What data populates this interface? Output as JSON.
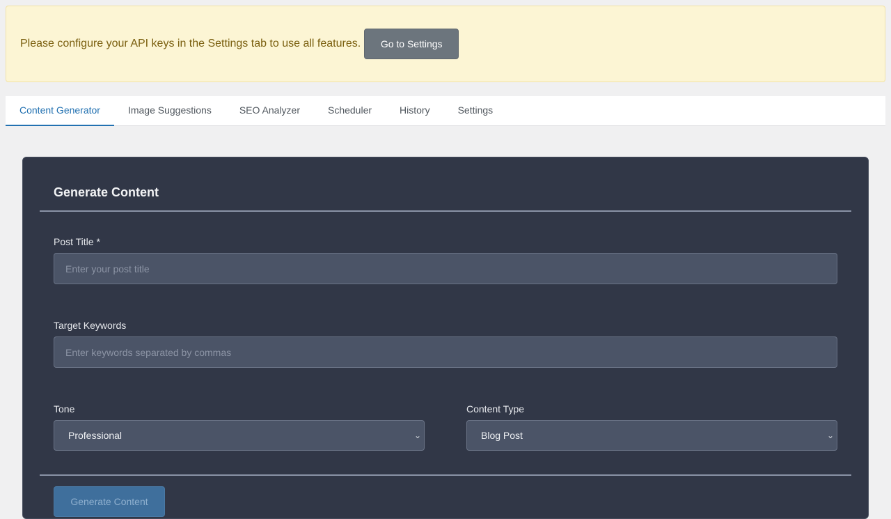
{
  "notice": {
    "message": "Please configure your API keys in the Settings tab to use all features.",
    "button_label": "Go to Settings"
  },
  "tabs": [
    {
      "label": "Content Generator",
      "active": true
    },
    {
      "label": "Image Suggestions",
      "active": false
    },
    {
      "label": "SEO Analyzer",
      "active": false
    },
    {
      "label": "Scheduler",
      "active": false
    },
    {
      "label": "History",
      "active": false
    },
    {
      "label": "Settings",
      "active": false
    }
  ],
  "form": {
    "title": "Generate Content",
    "post_title": {
      "label": "Post Title *",
      "value": "",
      "placeholder": "Enter your post title"
    },
    "keywords": {
      "label": "Target Keywords",
      "value": "",
      "placeholder": "Enter keywords separated by commas"
    },
    "tone": {
      "label": "Tone",
      "value": "Professional"
    },
    "content_type": {
      "label": "Content Type",
      "value": "Blog Post"
    },
    "submit_label": "Generate Content"
  },
  "colors": {
    "accent": "#2271b1",
    "panel_bg": "#313747",
    "notice_bg": "#fcf5d4",
    "notice_text": "#7a5f0f"
  }
}
